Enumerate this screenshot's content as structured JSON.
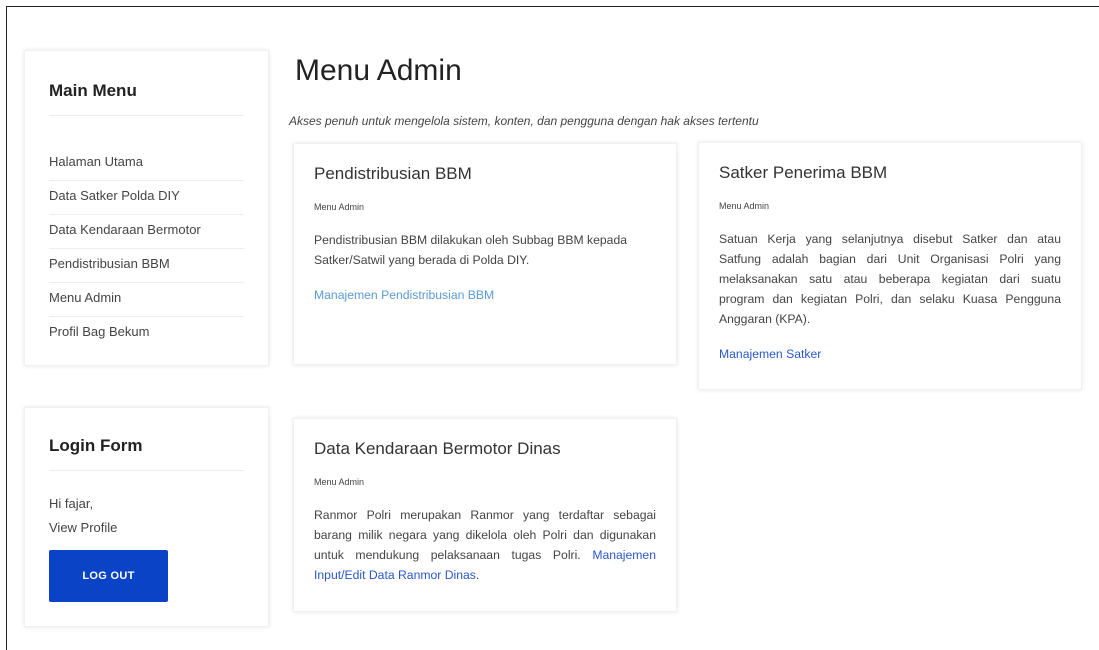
{
  "sidebar": {
    "title": "Main Menu",
    "items": [
      {
        "label": "Halaman Utama"
      },
      {
        "label": "Data Satker Polda DIY"
      },
      {
        "label": "Data Kendaraan Bermotor"
      },
      {
        "label": "Pendistribusian BBM"
      },
      {
        "label": "Menu Admin"
      },
      {
        "label": "Profil Bag Bekum"
      }
    ]
  },
  "login": {
    "title": "Login Form",
    "greeting": "Hi fajar,",
    "view_profile": "View Profile",
    "logout_label": "LOG OUT"
  },
  "main": {
    "title": "Menu Admin",
    "subtitle": "Akses penuh untuk mengelola sistem, konten, dan pengguna dengan hak akses tertentu",
    "cards": [
      {
        "title": "Pendistribusian BBM",
        "subtitle": "Menu Admin",
        "description": "Pendistribusian BBM dilakukan oleh Subbag BBM kepada Satker/Satwil yang berada di Polda DIY.",
        "link": "Manajemen Pendistribusian BBM"
      },
      {
        "title": "Satker Penerima BBM",
        "subtitle": "Menu Admin",
        "description": "Satuan Kerja yang selanjutnya disebut Satker dan atau Satfung adalah bagian dari Unit Organisasi Polri yang melaksanakan satu atau beberapa kegiatan dari suatu program dan kegiatan Polri, dan selaku Kuasa Pengguna Anggaran (KPA).",
        "link": "Manajemen Satker"
      },
      {
        "title": "Data Kendaraan Bermotor Dinas",
        "subtitle": "Menu Admin",
        "description": "Ranmor Polri merupakan Ranmor yang terdaftar sebagai barang milik negara yang dikelola oleh Polri dan digunakan untuk mendukung pelaksanaan tugas Polri.",
        "link": "Manajemen Input/Edit Data Ranmor Dinas"
      }
    ]
  },
  "colors": {
    "accent": "#0a43c5",
    "link": "#2b58c9",
    "link_light": "#5b9bd5"
  }
}
